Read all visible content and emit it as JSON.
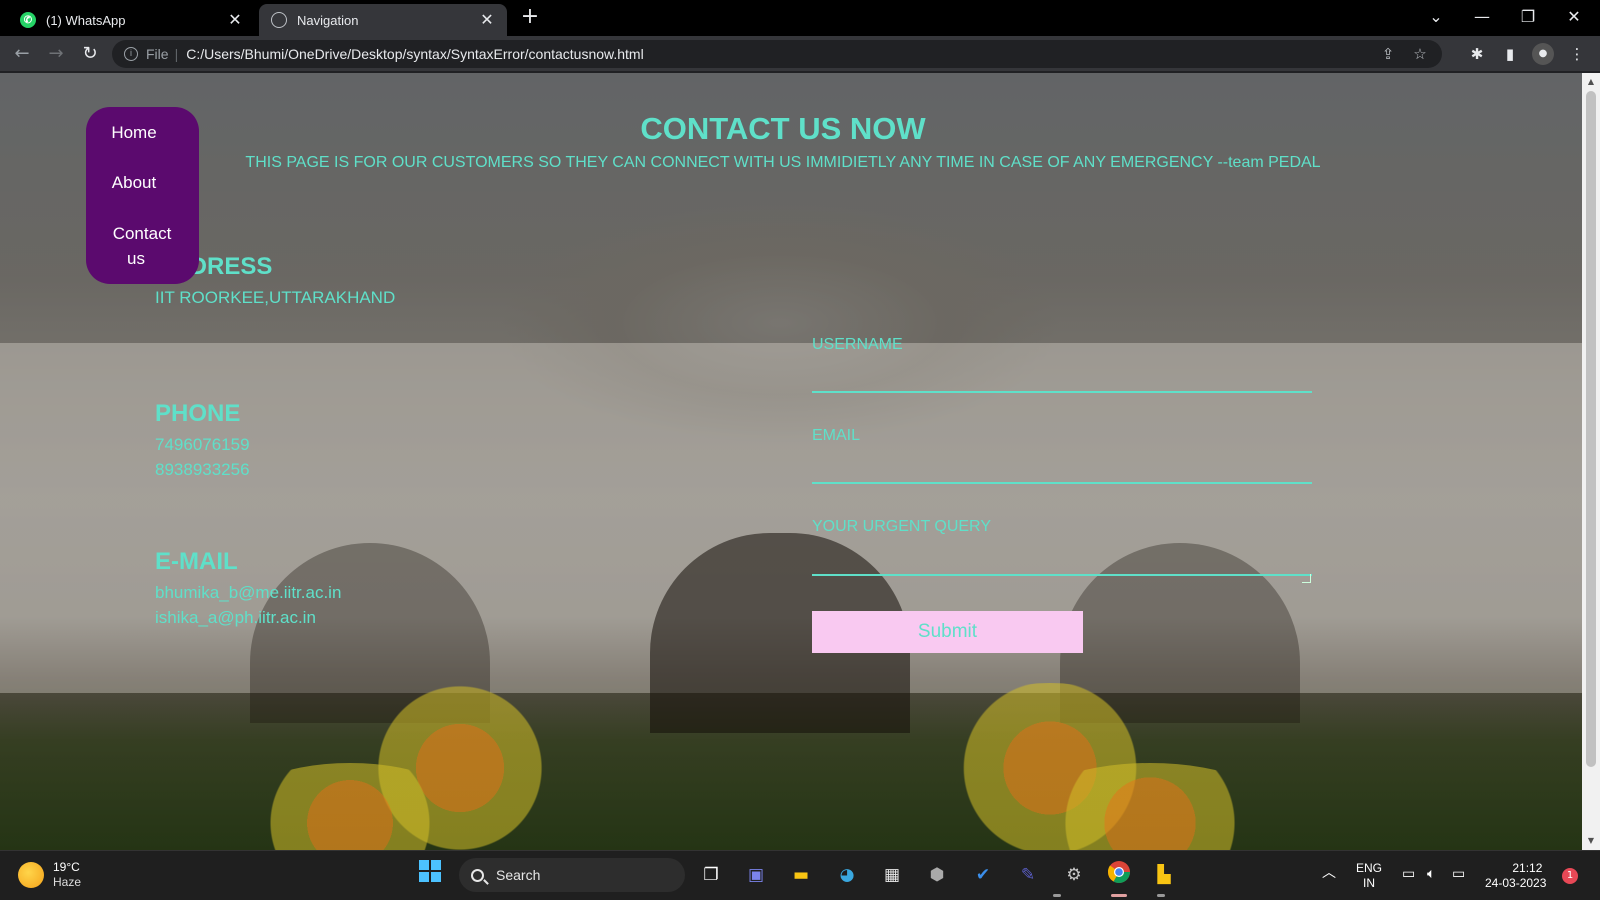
{
  "browser": {
    "tabs": [
      {
        "title": "(1) WhatsApp",
        "favicon": "whatsapp-icon",
        "active": false
      },
      {
        "title": "Navigation",
        "favicon": "globe-icon",
        "active": true
      }
    ],
    "new_tab": "+",
    "address": {
      "scheme": "File",
      "url": "C:/Users/Bhumi/OneDrive/Desktop/syntax/SyntaxError/contactusnow.html"
    }
  },
  "page": {
    "nav": {
      "items": [
        "Home",
        "About",
        "Contact",
        "us"
      ]
    },
    "heading": "CONTACT US NOW",
    "subheading": "THIS PAGE IS FOR OUR CUSTOMERS SO THEY CAN CONNECT WITH US IMMIDIETLY ANY TIME IN CASE OF ANY EMERGENCY --team PEDAL",
    "address": {
      "title": "ADDRESS",
      "value": "IIT ROORKEE,UTTARAKHAND"
    },
    "phone": {
      "title": "PHONE",
      "numbers": [
        "7496076159",
        "8938933256"
      ]
    },
    "email": {
      "title": "E-MAIL",
      "addresses": [
        "bhumika_b@me.iitr.ac.in",
        "ishika_a@ph.iitr.ac.in"
      ]
    },
    "form": {
      "username_label": "USERNAME",
      "email_label": "EMAIL",
      "query_label": "YOUR URGENT QUERY",
      "username_value": "",
      "email_value": "",
      "query_value": "",
      "submit_label": "Submit"
    },
    "colors": {
      "accent": "#5fe0c9",
      "nav_bg": "#5b0a6e",
      "submit_bg": "#f9c9f1"
    }
  },
  "taskbar": {
    "weather": {
      "temp": "19°C",
      "condition": "Haze"
    },
    "search_label": "Search",
    "language": {
      "line1": "ENG",
      "line2": "IN"
    },
    "clock": {
      "time": "21:12",
      "date": "24-03-2023"
    },
    "notification_count": "1"
  }
}
